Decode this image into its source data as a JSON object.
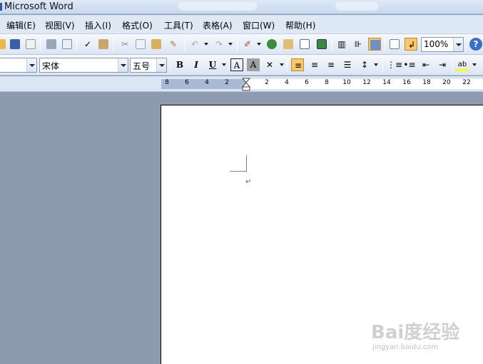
{
  "window": {
    "title": "Microsoft Word"
  },
  "menu": [
    {
      "id": "edit",
      "label": "编辑(E)"
    },
    {
      "id": "view",
      "label": "视图(V)"
    },
    {
      "id": "insert",
      "label": "插入(I)"
    },
    {
      "id": "format",
      "label": "格式(O)"
    },
    {
      "id": "tools",
      "label": "工具(T)"
    },
    {
      "id": "table",
      "label": "表格(A)"
    },
    {
      "id": "window",
      "label": "窗口(W)"
    },
    {
      "id": "help",
      "label": "帮助(H)"
    }
  ],
  "standard_toolbar": {
    "zoom": "100%"
  },
  "formatting_toolbar": {
    "font_name": "宋体",
    "font_size": "五号",
    "bold": "B",
    "italic": "I",
    "underline": "U",
    "char_border": "A",
    "char_shading": "A"
  },
  "ruler": {
    "ticks": [
      "8",
      "6",
      "4",
      "2",
      "2",
      "4",
      "6",
      "8",
      "10",
      "12",
      "14",
      "16",
      "18",
      "20",
      "22"
    ]
  },
  "document": {
    "paragraph_mark": "↵"
  },
  "watermark": {
    "brand": "Bai度经验",
    "url": "jingyan.baidu.com"
  },
  "colors": {
    "accent": "#3d6fc7",
    "active_button": "#f9c86a",
    "app_background": "#8e9aae"
  }
}
